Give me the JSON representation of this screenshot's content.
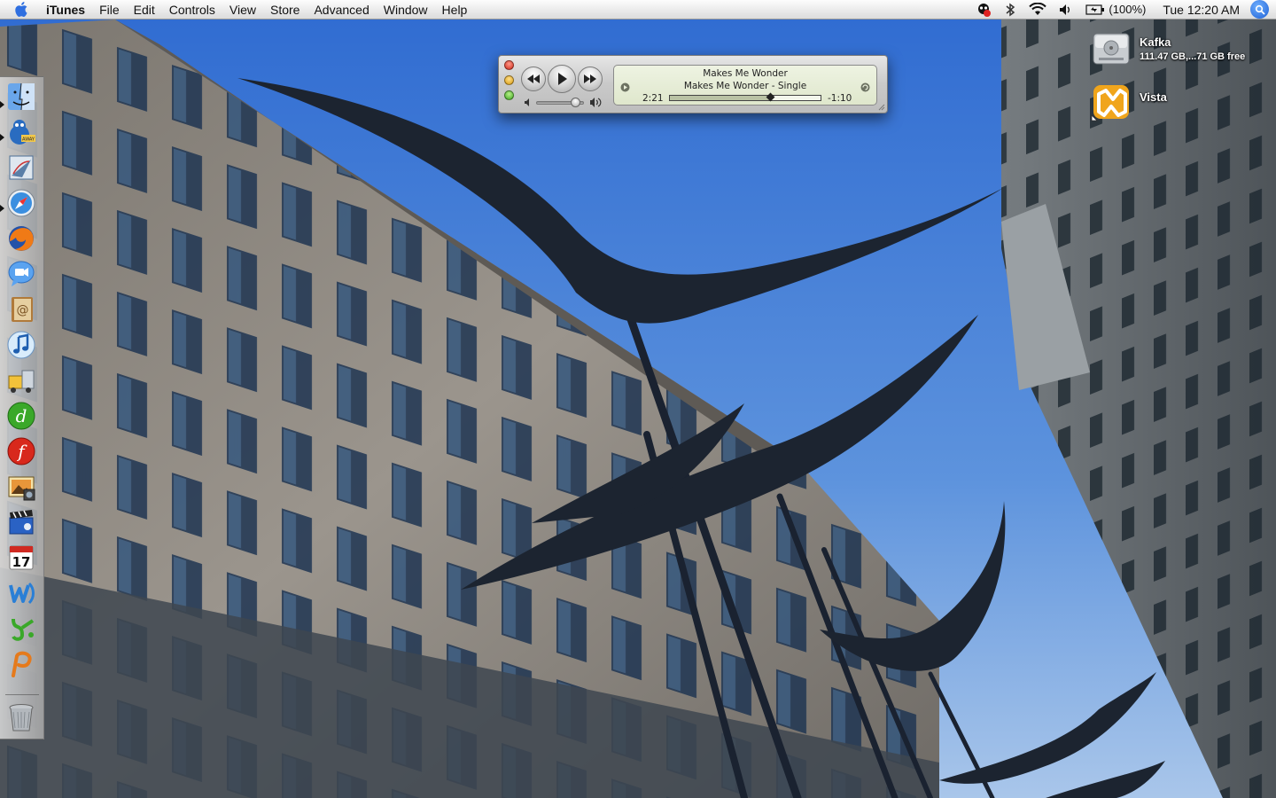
{
  "menubar": {
    "app_name": "iTunes",
    "menus": [
      "File",
      "Edit",
      "Controls",
      "View",
      "Store",
      "Advanced",
      "Window",
      "Help"
    ],
    "battery_text": "(100%)",
    "clock": "Tue 12:20 AM"
  },
  "mini_player": {
    "line1": "Makes Me Wonder",
    "line2": "Makes Me Wonder - Single",
    "elapsed": "2:21",
    "remaining": "-1:10",
    "progress": 0.67,
    "volume": 0.85
  },
  "desktop_icons": [
    {
      "label": "Kafka",
      "sub": "111.47 GB,...71 GB free",
      "icon": "hard-drive-icon"
    },
    {
      "label": "Vista",
      "sub": "",
      "icon": "vista-alias-icon"
    }
  ],
  "dock": {
    "items": [
      "finder-icon",
      "adium-icon",
      "mail-icon",
      "safari-icon",
      "firefox-icon",
      "ichat-icon",
      "address-book-icon",
      "itunes-icon",
      "transmit-icon",
      "dreamweaver-icon",
      "flash-icon",
      "iphoto-icon",
      "imovie-icon",
      "ical-icon",
      "contribute-icon",
      "fireworks-icon",
      "pages-icon",
      "trash-icon"
    ]
  },
  "colors": {
    "sky": "#4a7fd0",
    "building": "#8d8a86",
    "sculpture": "#1c2430"
  }
}
